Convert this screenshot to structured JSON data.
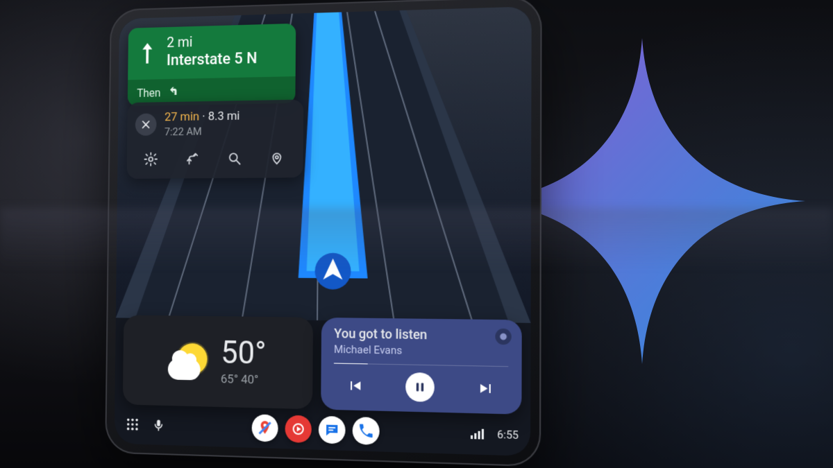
{
  "nav": {
    "distance": "2 mi",
    "road": "Interstate 5 N",
    "then_label": "Then"
  },
  "eta": {
    "duration": "27 min",
    "distance": "8.3 mi",
    "arrival": "7:22 AM"
  },
  "weather": {
    "temp": "50°",
    "high": "65°",
    "low": "40°"
  },
  "music": {
    "title": "You got to listen",
    "artist": "Michael Evans",
    "progress_pct": 20
  },
  "status": {
    "time": "6:55"
  },
  "colors": {
    "nav_green": "#147a3d",
    "nav_green_dark": "#10622f",
    "route_blue": "#1e88ff",
    "route_blue_light": "#36b6ff",
    "music_card": "#3d4a86",
    "eta_highlight": "#f4b64d"
  }
}
